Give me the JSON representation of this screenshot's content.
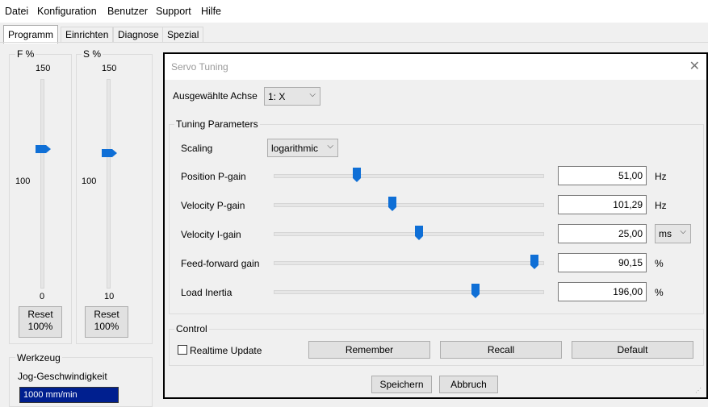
{
  "menu": [
    "Datei",
    "Konfiguration",
    "Benutzer",
    "Support",
    "Hilfe"
  ],
  "tabs": [
    "Programm",
    "Einrichten",
    "Diagnose",
    "Spezial"
  ],
  "feed_override": {
    "label": "F %",
    "max": "150",
    "mid": "100",
    "min": "0",
    "value_percent": 100,
    "reset": [
      "Reset",
      "100%"
    ]
  },
  "spindle_override": {
    "label": "S %",
    "max": "150",
    "mid": "100",
    "min": "10",
    "value_percent": 100,
    "reset": [
      "Reset",
      "100%"
    ]
  },
  "tool_group": {
    "label": "Werkzeug",
    "jog_label": "Jog-Geschwindigkeit",
    "jog_value": "1000 mm/min"
  },
  "dialog": {
    "title": "Servo Tuning",
    "close_icon": "close-icon",
    "axis_label": "Ausgewählte Achse",
    "axis_value": "1: X",
    "tuning_group": "Tuning Parameters",
    "scaling_label": "Scaling",
    "scaling_value": "logarithmic",
    "params": [
      {
        "label": "Position P-gain",
        "value": "51,00",
        "unit": "Hz",
        "slider_fraction": 0.31
      },
      {
        "label": "Velocity P-gain",
        "value": "101,29",
        "unit": "Hz",
        "slider_fraction": 0.44
      },
      {
        "label": "Velocity I-gain",
        "value": "25,00",
        "unit": "ms",
        "unit_is_dropdown": true,
        "slider_fraction": 0.54
      },
      {
        "label": "Feed-forward gain",
        "value": "90,15",
        "unit": "%",
        "slider_fraction": 0.97
      },
      {
        "label": "Load Inertia",
        "value": "196,00",
        "unit": "%",
        "slider_fraction": 0.75
      }
    ],
    "control_group": "Control",
    "realtime_label": "Realtime Update",
    "realtime_checked": false,
    "remember": "Remember",
    "recall": "Recall",
    "default": "Default",
    "save": "Speichern",
    "cancel": "Abbruch"
  }
}
